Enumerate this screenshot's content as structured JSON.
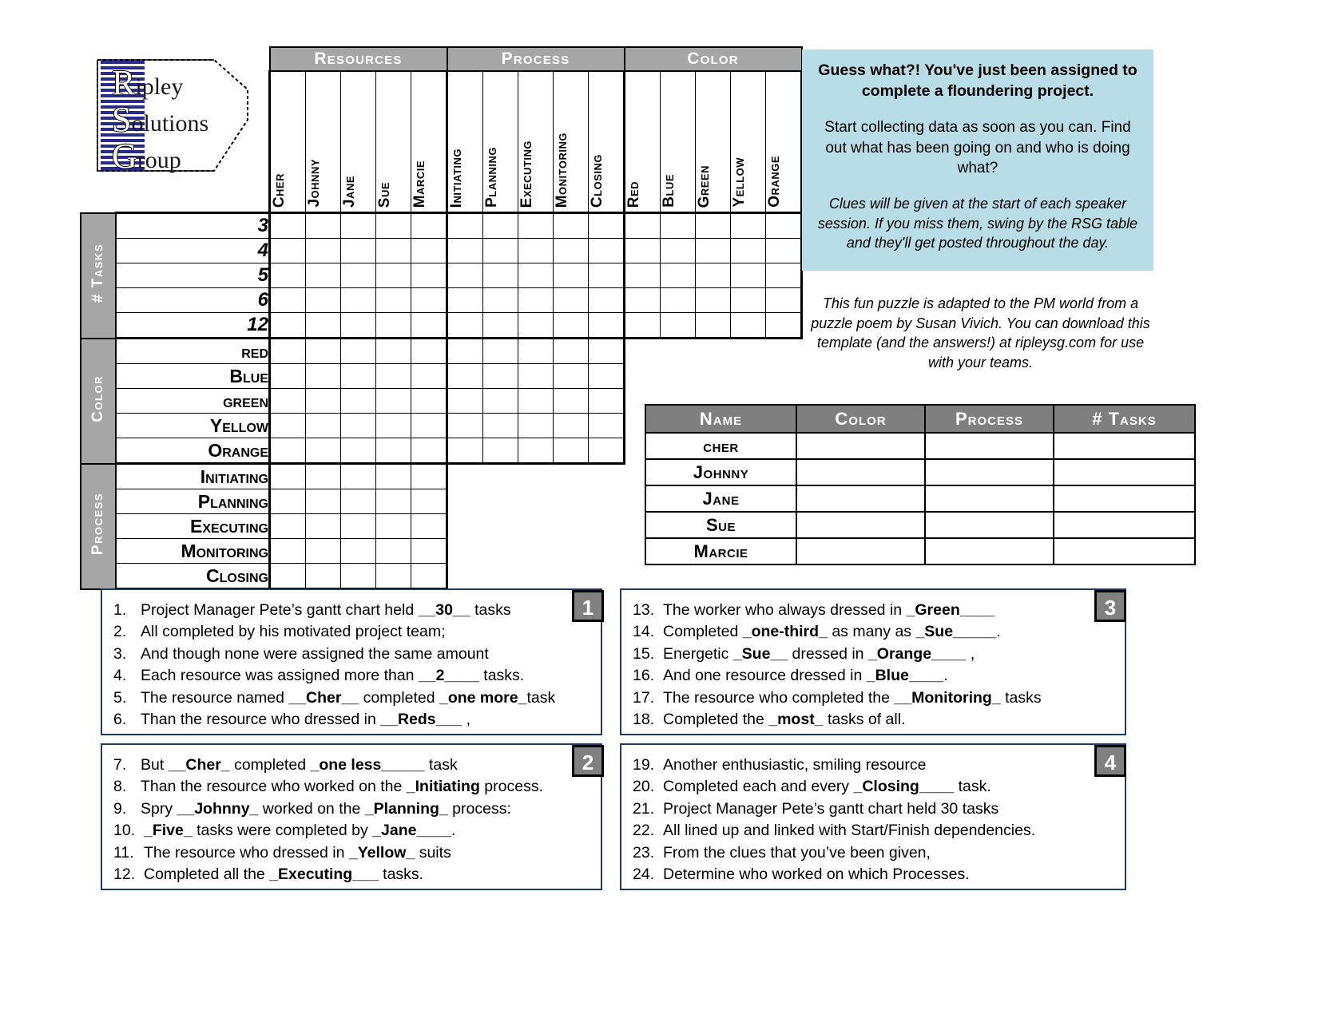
{
  "logo": {
    "line1_cap": "R",
    "line1_rest": "ipley",
    "line2_cap": "S",
    "line2_rest": "olutions",
    "line3_cap": "G",
    "line3_rest": "roup"
  },
  "grid": {
    "category_headers": [
      "Resources",
      "Process",
      "Color"
    ],
    "columns": {
      "resources": [
        "Cher",
        "Johnny",
        "Jane",
        "Sue",
        "Marcie"
      ],
      "process": [
        "Initiating",
        "Planning",
        "Executing",
        "Monitoring",
        "Closing"
      ],
      "color": [
        "Red",
        "Blue",
        "Green",
        "Yellow",
        "Orange"
      ]
    },
    "row_groups": [
      {
        "label": "# Tasks",
        "rows": [
          "3",
          "4",
          "5",
          "6",
          "12"
        ],
        "span_cols": 15,
        "numeric": true
      },
      {
        "label": "Color",
        "rows": [
          "red",
          "Blue",
          "green",
          "Yellow",
          "Orange"
        ],
        "span_cols": 10,
        "numeric": false
      },
      {
        "label": "Process",
        "rows": [
          "Initiating",
          "Planning",
          "Executing",
          "Monitoring",
          "Closing"
        ],
        "span_cols": 5,
        "numeric": false
      }
    ]
  },
  "info": {
    "title": "Guess what?! You've just been assigned to complete a floundering project.",
    "body": "Start collecting data as soon as you can.  Find out what has been going on and who is doing what?",
    "note": "Clues will be given at the start of each speaker session.  If you miss them, swing by the RSG table and they'll get posted throughout the day.",
    "credit": "This fun puzzle is adapted to the PM world from a puzzle poem by Susan Vivich.  You can download this template (and the answers!) at ripleysg.com for use with your teams."
  },
  "answer_table": {
    "headers": [
      "Name",
      "Color",
      "Process",
      "# Tasks"
    ],
    "rows": [
      "cher",
      "Johnny",
      "Jane",
      "Sue",
      "Marcie"
    ]
  },
  "clues": [
    {
      "badge": "1",
      "items": [
        {
          "num": "1.",
          "parts": [
            {
              "t": "Project Manager Pete’s gantt chart held ",
              "b": false
            },
            {
              "t": "__30__",
              "b": true
            },
            {
              "t": " tasks",
              "b": false
            }
          ]
        },
        {
          "num": "2.",
          "parts": [
            {
              "t": "All completed by his motivated project team;",
              "b": false
            }
          ]
        },
        {
          "num": "3.",
          "parts": [
            {
              "t": "And though none were assigned the same amount",
              "b": false
            }
          ]
        },
        {
          "num": "4.",
          "parts": [
            {
              "t": "Each resource was assigned more than ",
              "b": false
            },
            {
              "t": "__2____",
              "b": true
            },
            {
              "t": " tasks.",
              "b": false
            }
          ]
        },
        {
          "num": "5.",
          "parts": [
            {
              "t": "The resource named ",
              "b": false
            },
            {
              "t": "__Cher__",
              "b": true
            },
            {
              "t": " completed ",
              "b": false
            },
            {
              "t": "_one more_",
              "b": true
            },
            {
              "t": "task",
              "b": false
            }
          ]
        },
        {
          "num": "6.",
          "parts": [
            {
              "t": "Than the resource who dressed in ",
              "b": false
            },
            {
              "t": "__Reds___",
              "b": true
            },
            {
              "t": " ,",
              "b": false
            }
          ]
        }
      ]
    },
    {
      "badge": "2",
      "items": [
        {
          "num": "7.",
          "parts": [
            {
              "t": "But ",
              "b": false
            },
            {
              "t": "__Cher_",
              "b": true
            },
            {
              "t": " completed ",
              "b": false
            },
            {
              "t": "_one less_____",
              "b": true
            },
            {
              "t": " task",
              "b": false
            }
          ]
        },
        {
          "num": "8.",
          "parts": [
            {
              "t": "Than the resource who worked on the ",
              "b": false
            },
            {
              "t": "_Initiating",
              "b": true
            },
            {
              "t": " process.",
              "b": false
            }
          ]
        },
        {
          "num": "9.",
          "parts": [
            {
              "t": "Spry  ",
              "b": false
            },
            {
              "t": "__Johnny_",
              "b": true
            },
            {
              "t": " worked on the ",
              "b": false
            },
            {
              "t": "_Planning_",
              "b": true
            },
            {
              "t": " process:",
              "b": false
            }
          ]
        },
        {
          "num": "10.",
          "parts": [
            {
              "t": "_Five_",
              "b": true
            },
            {
              "t": " tasks were completed by ",
              "b": false
            },
            {
              "t": "_Jane____",
              "b": true
            },
            {
              "t": ".",
              "b": false
            }
          ]
        },
        {
          "num": "11.",
          "parts": [
            {
              "t": "The resource who dressed in ",
              "b": false
            },
            {
              "t": "_Yellow_",
              "b": true
            },
            {
              "t": " suits",
              "b": false
            }
          ]
        },
        {
          "num": "12.",
          "parts": [
            {
              "t": "Completed all the ",
              "b": false
            },
            {
              "t": "_Executing___",
              "b": true
            },
            {
              "t": " tasks.",
              "b": false
            }
          ]
        }
      ]
    },
    {
      "badge": "3",
      "items": [
        {
          "num": "13.",
          "parts": [
            {
              "t": "The worker who always dressed in ",
              "b": false
            },
            {
              "t": "_Green____",
              "b": true
            }
          ]
        },
        {
          "num": "14.",
          "parts": [
            {
              "t": "Completed ",
              "b": false
            },
            {
              "t": "_one-third_",
              "b": true
            },
            {
              "t": " as many as ",
              "b": false
            },
            {
              "t": "_Sue_____",
              "b": true
            },
            {
              "t": ".",
              "b": false
            }
          ]
        },
        {
          "num": "15.",
          "parts": [
            {
              "t": "Energetic ",
              "b": false
            },
            {
              "t": "_Sue__",
              "b": true
            },
            {
              "t": " dressed in ",
              "b": false
            },
            {
              "t": "_Orange____",
              "b": true
            },
            {
              "t": " ,",
              "b": false
            }
          ]
        },
        {
          "num": "16.",
          "parts": [
            {
              "t": "And one resource dressed in ",
              "b": false
            },
            {
              "t": "_Blue____",
              "b": true
            },
            {
              "t": ".",
              "b": false
            }
          ]
        },
        {
          "num": "17.",
          "parts": [
            {
              "t": "The resource who completed the ",
              "b": false
            },
            {
              "t": "__Monitoring_",
              "b": true
            },
            {
              "t": " tasks",
              "b": false
            }
          ]
        },
        {
          "num": "18.",
          "parts": [
            {
              "t": "Completed the ",
              "b": false
            },
            {
              "t": "_most_",
              "b": true
            },
            {
              "t": " tasks of all.",
              "b": false
            }
          ]
        }
      ]
    },
    {
      "badge": "4",
      "items": [
        {
          "num": "19.",
          "parts": [
            {
              "t": "Another enthusiastic, smiling resource",
              "b": false
            }
          ]
        },
        {
          "num": "20.",
          "parts": [
            {
              "t": "Completed each and every ",
              "b": false
            },
            {
              "t": "_Closing____",
              "b": true
            },
            {
              "t": " task.",
              "b": false
            }
          ]
        },
        {
          "num": "21.",
          "parts": [
            {
              "t": "Project Manager Pete’s gantt chart held 30 tasks",
              "b": false
            }
          ]
        },
        {
          "num": "22.",
          "parts": [
            {
              "t": "All lined up and linked with Start/Finish dependencies.",
              "b": false
            }
          ]
        },
        {
          "num": "23.",
          "parts": [
            {
              "t": "From the clues that you’ve been given,",
              "b": false
            }
          ]
        },
        {
          "num": "24.",
          "parts": [
            {
              "t": "Determine who worked on which Processes.",
              "b": false
            }
          ]
        }
      ]
    }
  ],
  "colors": {
    "category_header_bg": "#a6a6a6",
    "answer_header_bg": "#7f7f7f",
    "info_box_bg": "#b9dde6",
    "clue_border": "#1f3864",
    "logo_blue": "#2a2a8c"
  }
}
